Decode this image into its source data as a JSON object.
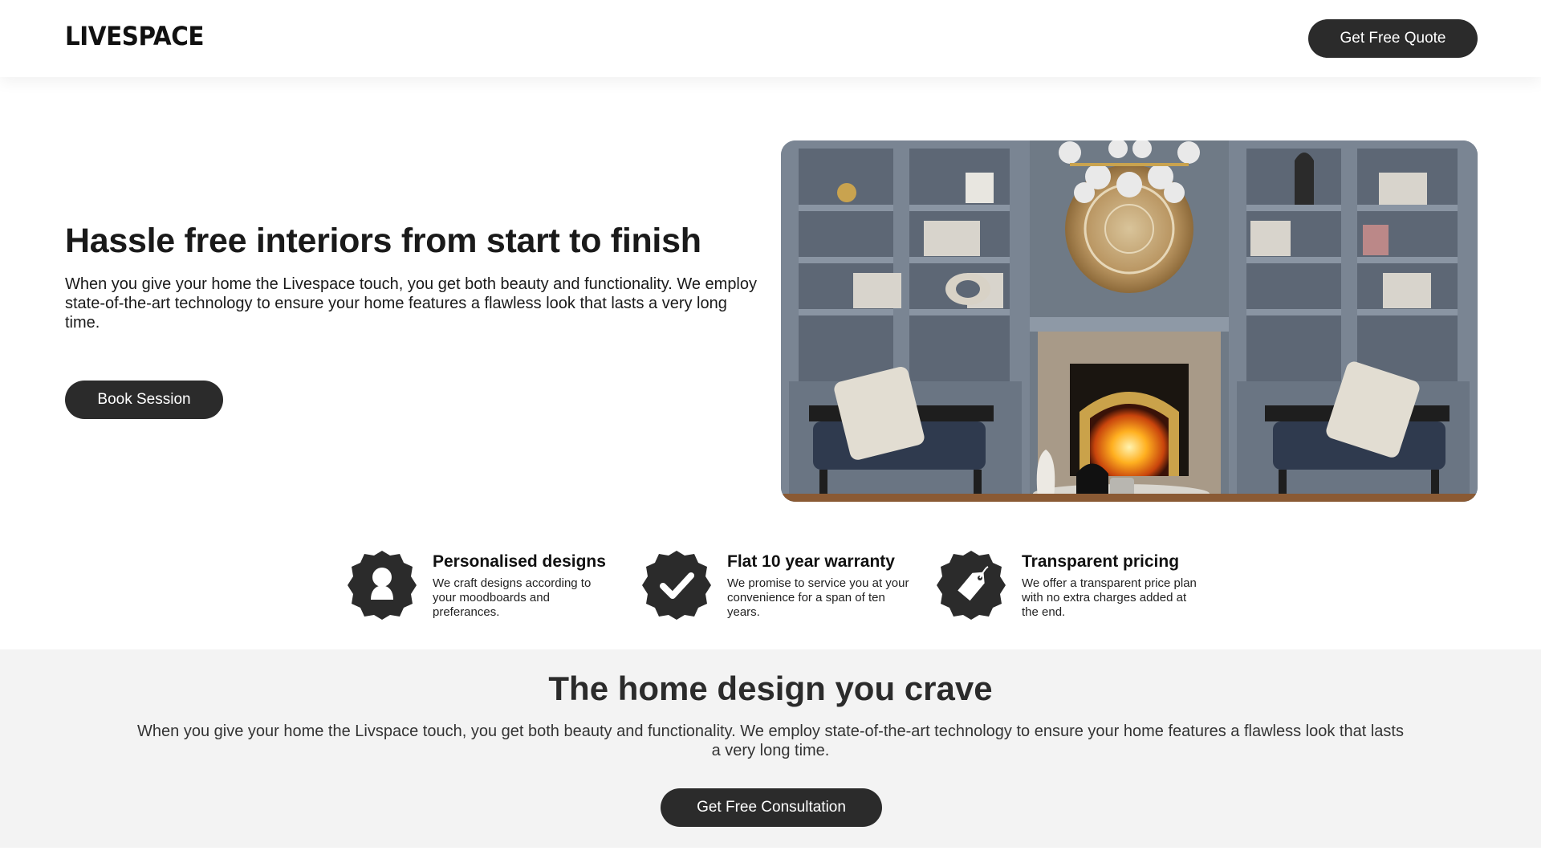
{
  "header": {
    "logo": "LIVESPACE",
    "quote_button": "Get Free Quote"
  },
  "hero": {
    "title": "Hassle free interiors from start to finish",
    "description": "When you give your home the Livespace touch, you get both beauty and functionality. We employ state-of-the-art technology to ensure your home features a flawless look that lasts a very long time.",
    "book_button": "Book Session",
    "image_subject": "living-room-fireplace-photo"
  },
  "features": [
    {
      "icon": "person-badge-icon",
      "title": "Personalised designs",
      "description": "We craft designs according to your moodboards and preferances."
    },
    {
      "icon": "checkmark-badge-icon",
      "title": "Flat 10 year warranty",
      "description": "We promise to service you at your convenience for a span of ten years."
    },
    {
      "icon": "price-tag-badge-icon",
      "title": "Transparent pricing",
      "description": "We offer a transparent price plan with no extra charges added at the end."
    }
  ],
  "crave": {
    "title": "The home design you crave",
    "description": "When you give your home the Livspace touch, you get both beauty and functionality. We employ state-of-the-art technology to ensure your home features a flawless look that lasts a very long time.",
    "consult_button": "Get Free Consultation"
  },
  "colors": {
    "button_bg": "#2b2b2b",
    "section_bg": "#f3f3f3",
    "text": "#1a1a1a"
  }
}
